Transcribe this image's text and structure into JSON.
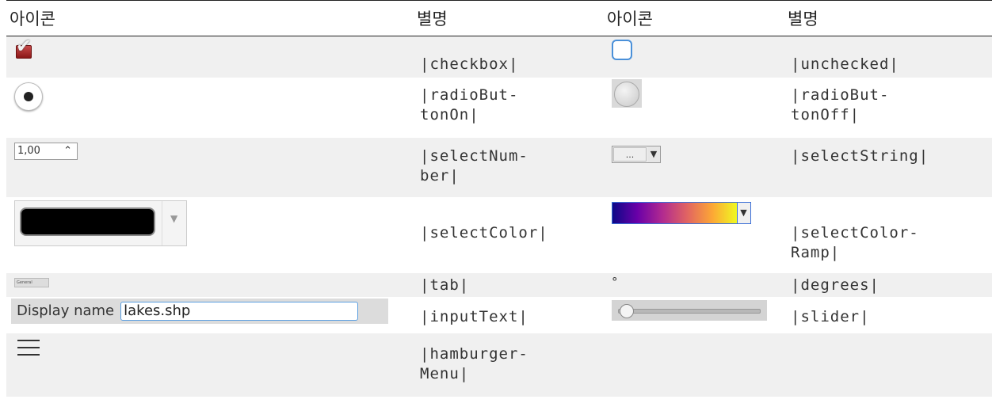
{
  "headers": [
    "아이콘",
    "별명",
    "아이콘",
    "별명"
  ],
  "rows": [
    {
      "left_alias": "|checkbox|",
      "right_alias": "|unchecked|"
    },
    {
      "left_alias": "|radioBut-\ntonOn|",
      "right_alias": "|radioBut-\ntonOff|"
    },
    {
      "left_alias": "|selectNum-\nber|",
      "right_alias": "|selectString|"
    },
    {
      "left_alias": "|selectColor|",
      "right_alias": "|selectColor-\nRamp|"
    },
    {
      "left_alias": "|tab|",
      "right_alias": "|degrees|"
    },
    {
      "left_alias": "|inputText|",
      "right_alias": "|slider|"
    },
    {
      "left_alias": "|hamburger-\nMenu|",
      "right_alias": ""
    }
  ],
  "icons": {
    "spin_value": "1,00",
    "spin_arrows": "⌃",
    "select_string_dots": "...",
    "select_arrow": "▼",
    "color_dropdown_arrow": "▼",
    "tab_label": "General",
    "degree_symbol": "°",
    "input_label": "Display name",
    "input_value": "lakes.shp",
    "colors": {
      "ramp_border": "#3b6fd6",
      "checkbox_red": "#b32626",
      "unchecked_blue": "#4a90d9"
    }
  }
}
